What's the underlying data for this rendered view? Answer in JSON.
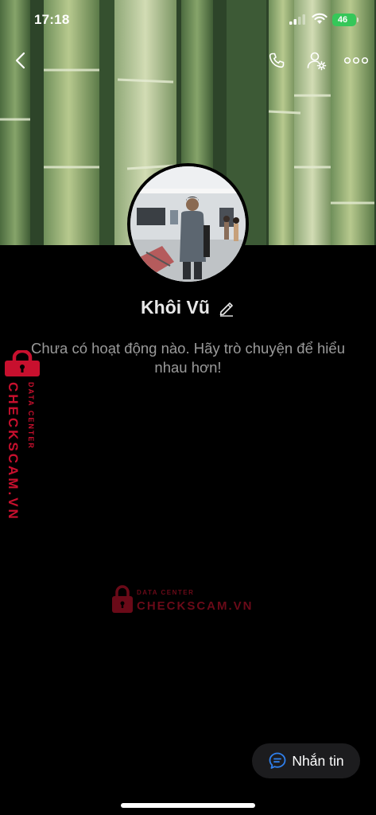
{
  "status_bar": {
    "time": "17:18",
    "battery_label": "46"
  },
  "header": {
    "icons": [
      "chevron-left-icon",
      "phone-icon",
      "user-settings-icon",
      "more-dots-icon"
    ]
  },
  "profile": {
    "name": "Khôi Vũ",
    "empty_message": "Chưa có hoạt động nào. Hãy trò chuyện để hiểu nhau hơn!"
  },
  "watermark": {
    "brand": "CHECKSCAM.VN",
    "subtitle": "DATA CENTER"
  },
  "actions": {
    "message_label": "Nhắn tin"
  },
  "colors": {
    "accent": "#2f80ed",
    "watermark_red": "#c8102e",
    "button_bg": "#1c1c1e"
  }
}
